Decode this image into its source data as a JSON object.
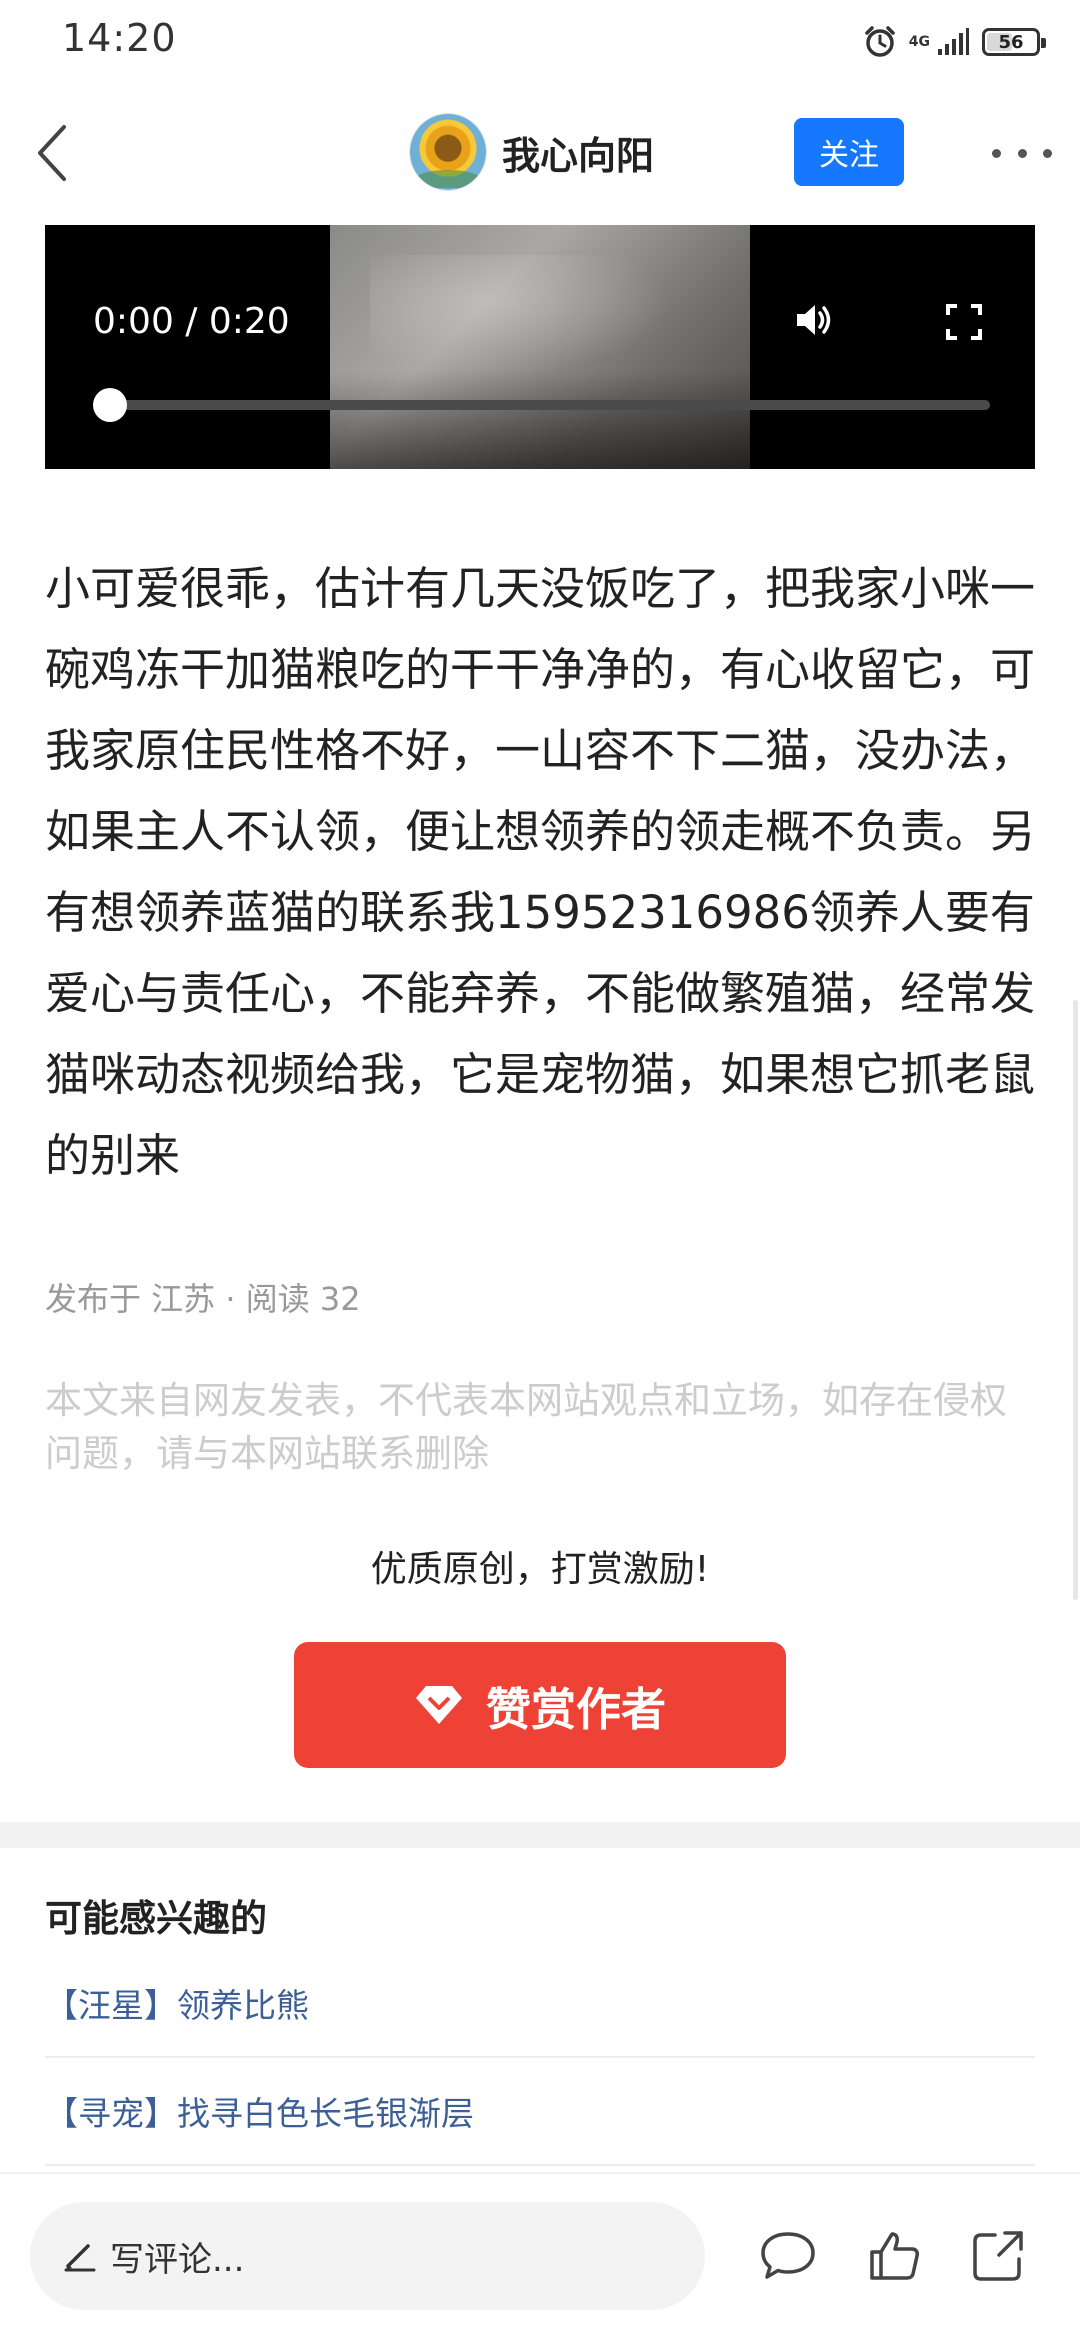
{
  "status_bar": {
    "time": "14:20",
    "network": "4G",
    "battery": "56",
    "battery_level": 0.56
  },
  "header": {
    "author_name": "我心向阳",
    "follow_label": "关注"
  },
  "video": {
    "time_display": "0:00 / 0:20",
    "progress": 0
  },
  "article": {
    "body": "小可爱很乖，估计有几天没饭吃了，把我家小咪一碗鸡冻干加猫粮吃的干干净净的，有心收留它，可我家原住民性格不好，一山容不下二猫，没办法，如果主人不认领，便让想领养的领走概不负责。另有想领养蓝猫的联系我15952316986领养人要有爱心与责任心，不能弃养，不能做繁殖猫，经常发猫咪动态视频给我，它是宠物猫，如果想它抓老鼠的别来",
    "meta": "发布于 江苏 · 阅读 32",
    "disclaimer": "本文来自网友发表，不代表本网站观点和立场，如存在侵权问题，请与本网站联系删除"
  },
  "reward": {
    "slogan": "优质原创，打赏激励!",
    "button_label": "赞赏作者"
  },
  "related": {
    "title": "可能感兴趣的",
    "items": [
      {
        "label": "【汪星】领养比熊"
      },
      {
        "label": "【寻宠】找寻白色长毛银渐层"
      }
    ]
  },
  "bottom_bar": {
    "comment_placeholder": "写评论..."
  },
  "colors": {
    "accent_blue": "#1677ff",
    "reward_red": "#ef4236",
    "link_blue": "#3d5f98"
  }
}
